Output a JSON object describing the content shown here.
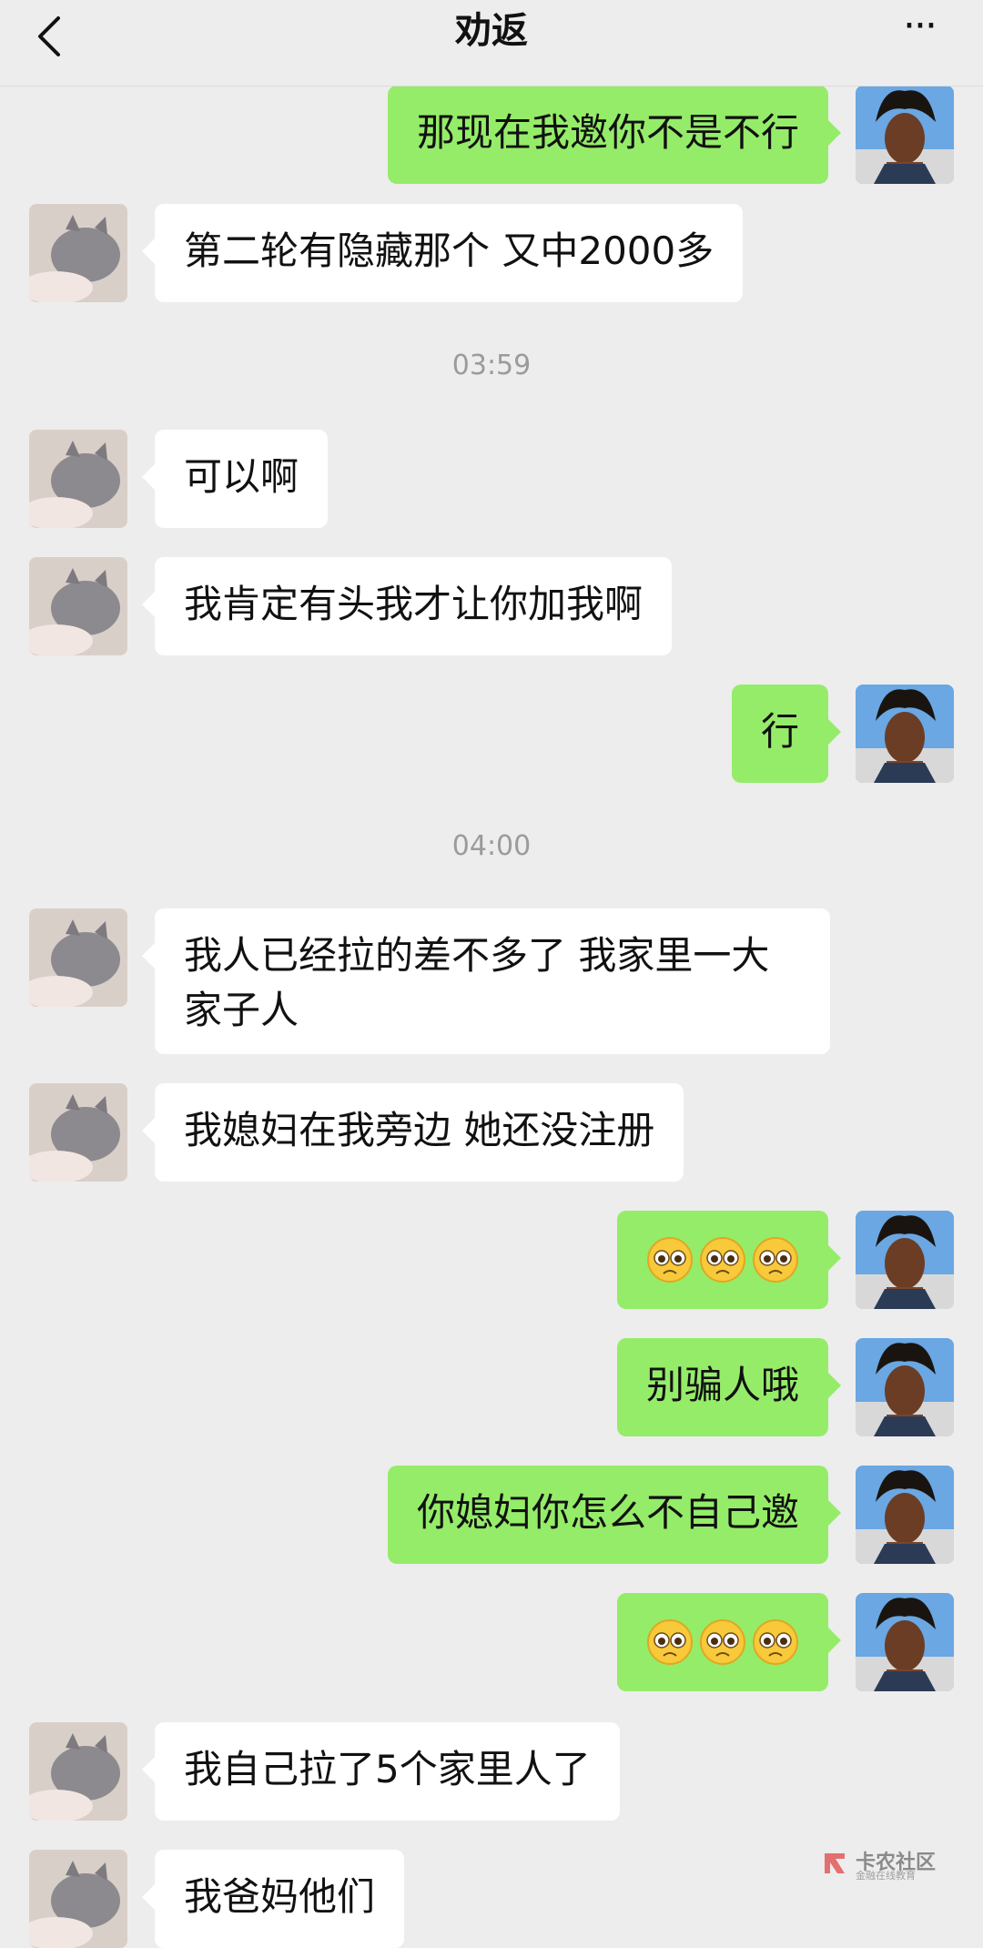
{
  "header": {
    "title": "劝返",
    "more_label": "···"
  },
  "messages": [
    {
      "side": "right",
      "text": "那现在我邀你不是不行"
    },
    {
      "side": "left",
      "text": "第二轮有隐藏那个 又中2000多"
    },
    {
      "timestamp": "03:59"
    },
    {
      "side": "left",
      "text": "可以啊"
    },
    {
      "side": "left",
      "text": "我肯定有头我才让你加我啊"
    },
    {
      "side": "right",
      "text": "行"
    },
    {
      "timestamp": "04:00"
    },
    {
      "side": "left",
      "text": "我人已经拉的差不多了 我家里一大家子人"
    },
    {
      "side": "left",
      "text": "我媳妇在我旁边 她还没注册"
    },
    {
      "side": "right",
      "emoji": "pleading-face-x3"
    },
    {
      "side": "right",
      "text": "别骗人哦"
    },
    {
      "side": "right",
      "text": "你媳妇你怎么不自己邀"
    },
    {
      "side": "right",
      "emoji": "pleading-face-x3"
    },
    {
      "side": "left",
      "text": "我自己拉了5个家里人了"
    },
    {
      "side": "left",
      "text": "我爸妈他们"
    }
  ],
  "watermark": {
    "text": "卡农社区",
    "sub": "金融在线教育"
  },
  "colors": {
    "background": "#ededed",
    "self_bubble": "#95ec69",
    "other_bubble": "#ffffff"
  }
}
